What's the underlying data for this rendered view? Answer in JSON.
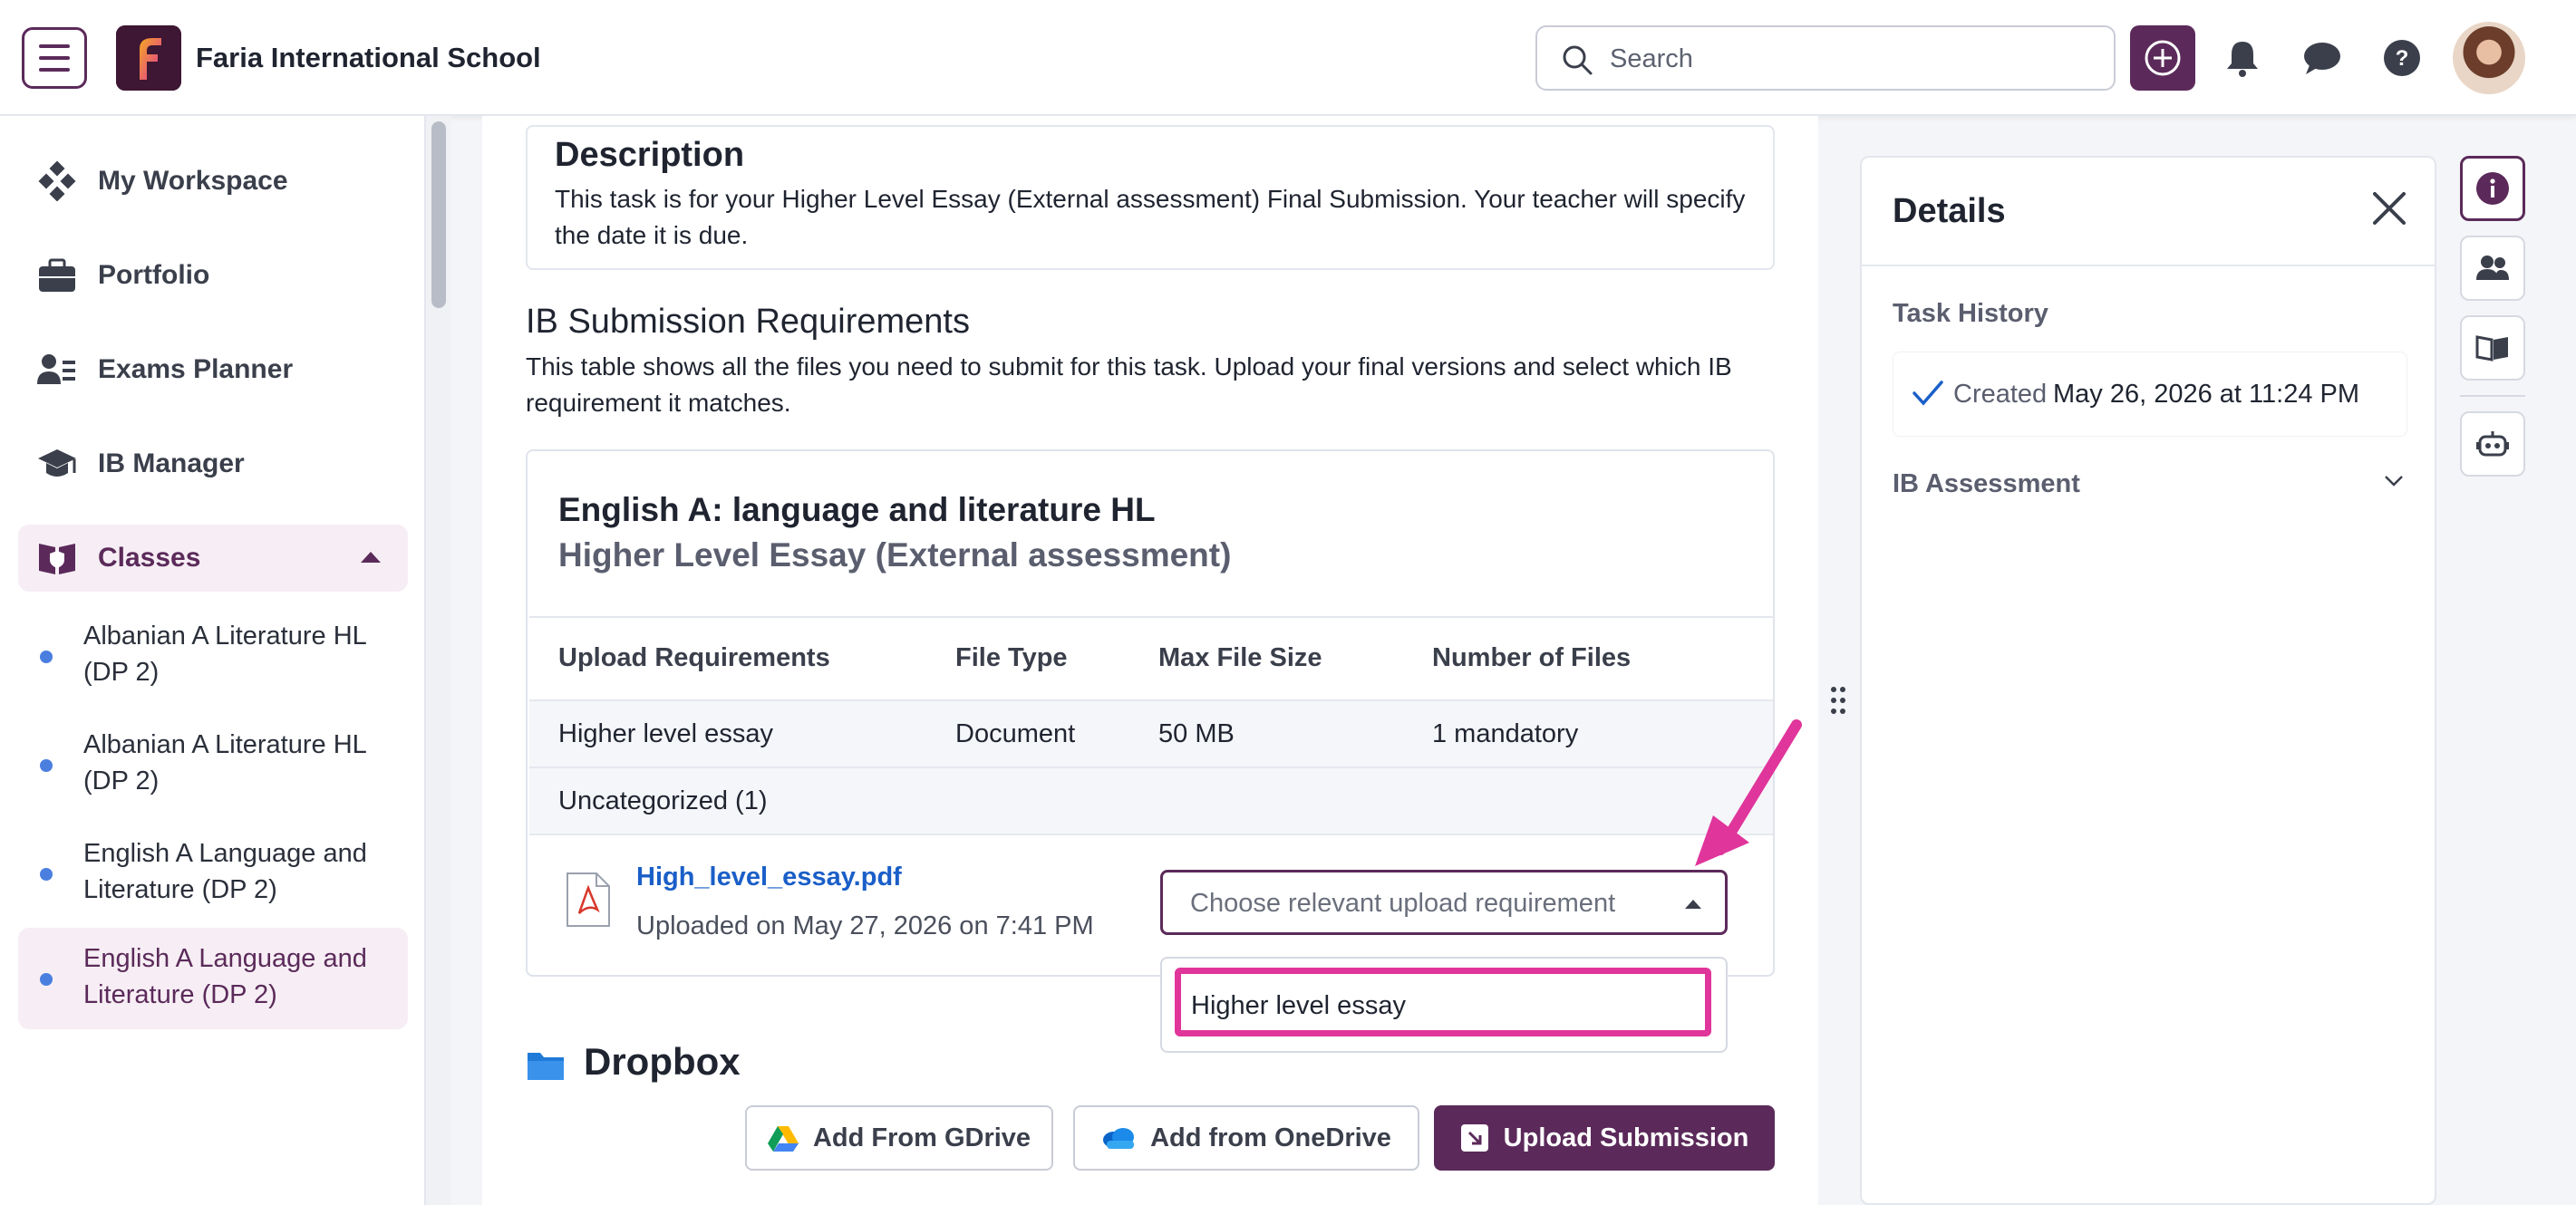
{
  "header": {
    "school_name": "Faria International School",
    "search_placeholder": "Search"
  },
  "sidebar": {
    "nav": [
      {
        "label": "My Workspace",
        "icon": "workspace-icon"
      },
      {
        "label": "Portfolio",
        "icon": "briefcase-icon"
      },
      {
        "label": "Exams Planner",
        "icon": "people-list-icon"
      },
      {
        "label": "IB Manager",
        "icon": "graduation-cap-icon"
      },
      {
        "label": "Classes",
        "icon": "book-shield-icon",
        "expanded": true
      }
    ],
    "classes": [
      {
        "label": "Albanian A Literature HL (DP 2)"
      },
      {
        "label": "Albanian A Literature HL (DP 2)"
      },
      {
        "label": "English A Language and Literature (DP 2)"
      },
      {
        "label": "English A Language and Literature (DP 2)",
        "active": true
      }
    ]
  },
  "main": {
    "description": {
      "title": "Description",
      "text": "This task is for your Higher Level Essay (External assessment) Final Submission. Your teacher will specify the date it is due."
    },
    "requirements": {
      "heading": "IB Submission Requirements",
      "text": "This table shows all the files you need to submit for this task. Upload your final versions and select which IB requirement it matches.",
      "subject": "English A: language and literature HL",
      "assessment": "Higher Level Essay (External assessment)",
      "columns": [
        "Upload Requirements",
        "File Type",
        "Max File Size",
        "Number of Files"
      ],
      "rows": [
        [
          "Higher level essay",
          "Document",
          "50 MB",
          "1 mandatory"
        ]
      ],
      "group_label": "Uncategorized (1)",
      "file": {
        "name": "High_level_essay.pdf",
        "uploaded": "Uploaded on May 27, 2026 on 7:41 PM"
      },
      "select": {
        "placeholder": "Choose relevant upload requirement",
        "options": [
          "Higher level essay"
        ]
      }
    },
    "dropbox": {
      "title": "Dropbox",
      "buttons": {
        "gdrive": "Add From GDrive",
        "onedrive": "Add from OneDrive",
        "upload": "Upload Submission"
      }
    }
  },
  "details": {
    "title": "Details",
    "task_history": "Task History",
    "created_label": "Created",
    "created_date": "May 26, 2026 at 11:24 PM",
    "ib_assessment": "IB Assessment"
  },
  "colors": {
    "brand": "#5b2a5a",
    "highlight": "#e0359b",
    "link": "#1a5fc8"
  }
}
